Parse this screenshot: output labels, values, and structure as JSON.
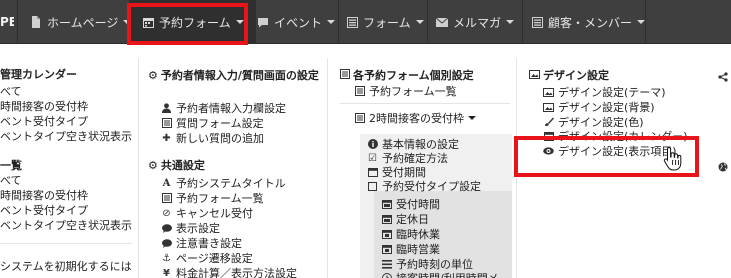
{
  "nav": {
    "brand": "PE",
    "items": [
      {
        "label": "ホームページ"
      },
      {
        "label": "予約フォーム"
      },
      {
        "label": "イベント"
      },
      {
        "label": "フォーム"
      },
      {
        "label": "メルマガ"
      },
      {
        "label": "顧客・メンバー"
      }
    ]
  },
  "col1": {
    "heading": "管理カレンダー",
    "items": [
      "べて",
      "時間接客の受付枠",
      "ベント受付タイプ",
      "ベント タイプ空き状況表示"
    ],
    "heading2": "一覧",
    "items2": [
      "べて",
      "時間接客の受付枠",
      "ベント受付タイプ",
      "ベントタイプ空き状況表示"
    ],
    "footer": "システムを初期化するには"
  },
  "col2": {
    "heading": "予約者情報入力/質問画面の設定",
    "items": [
      "予約者情報入力欄設定",
      "質問フォーム設定",
      "新しい質問の追加"
    ],
    "heading2": "共通設定",
    "items2": [
      "予約システムタイトル",
      "予約フォーム一覧",
      "キャンセル受付",
      "表示設定",
      "注意書き設定",
      "ページ遷移設定",
      "料金計算／表示方法設定"
    ]
  },
  "col3": {
    "heading": "各予約フォーム個別設定",
    "item1": "予約フォーム一覧",
    "dropdown": "2時間接客の受付枠",
    "items": [
      "基本情報の設定",
      "予約確定方法",
      "受付期間",
      "予約受付タイプ設定"
    ],
    "subitems": [
      "受付時間",
      "定休日",
      "臨時休業",
      "臨時営業",
      "予約時刻の単位",
      "接客時間/利用時間メ"
    ]
  },
  "col4": {
    "heading": "デザイン設定",
    "items": [
      "デザイン設定(テーマ)",
      "デザイン設定(背景)",
      "デザイン設定(色)",
      "デザイン設定(カレンダー)",
      "デザイン設定(表示項目)"
    ]
  }
}
